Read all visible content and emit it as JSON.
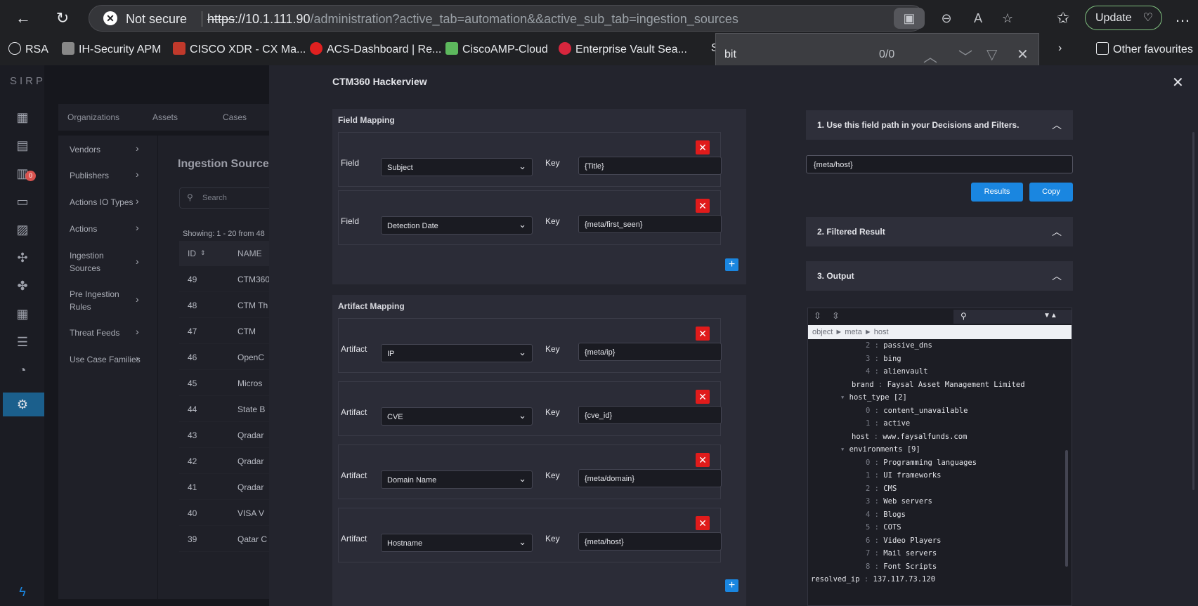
{
  "browser": {
    "security_label": "Not secure",
    "url_proto": "https",
    "url_host": "://10.1.111.90",
    "url_rest": "/administration?active_tab=automation&&active_sub_tab=ingestion_sources",
    "update_label": "Update",
    "bookmarks": [
      "RSA",
      "IH-Security APM",
      "CISCO XDR - CX Ma...",
      "ACS-Dashboard | Re...",
      "CiscoAMP-Cloud",
      "Enterprise Vault Sea...",
      "S"
    ],
    "other_favourites": "Other favourites",
    "find": {
      "query": "bit",
      "count": "0/0"
    }
  },
  "app": {
    "logo": "SIRP",
    "top_menu": [
      "Organizations",
      "Assets",
      "Cases"
    ],
    "submenu": [
      {
        "label": "Vendors"
      },
      {
        "label": "Publishers"
      },
      {
        "label": "Actions IO Types"
      },
      {
        "label": "Actions"
      },
      {
        "label": "Ingestion Sources"
      },
      {
        "label": "Pre Ingestion Rules"
      },
      {
        "label": "Threat Feeds"
      },
      {
        "label": "Use Case Families"
      }
    ],
    "badge": "0",
    "ingestion": {
      "title": "Ingestion Sources",
      "search_placeholder": "Search",
      "showing": "Showing: 1 - 20 from 48",
      "headers": [
        "ID",
        "NAME"
      ],
      "rows": [
        {
          "id": "49",
          "name": "CTM360"
        },
        {
          "id": "48",
          "name": "CTM Th"
        },
        {
          "id": "47",
          "name": "CTM"
        },
        {
          "id": "46",
          "name": "OpenC"
        },
        {
          "id": "45",
          "name": "Micros"
        },
        {
          "id": "44",
          "name": "State B"
        },
        {
          "id": "43",
          "name": "Qradar"
        },
        {
          "id": "42",
          "name": "Qradar"
        },
        {
          "id": "41",
          "name": "Qradar"
        },
        {
          "id": "40",
          "name": "VISA V"
        },
        {
          "id": "39",
          "name": "Qatar C"
        }
      ]
    }
  },
  "modal": {
    "title": "CTM360 Hackerview",
    "field_mapping": {
      "title": "Field Mapping",
      "rows": [
        {
          "label": "Field",
          "value": "Subject",
          "key_label": "Key",
          "key": "{Title}"
        },
        {
          "label": "Field",
          "value": "Detection Date",
          "key_label": "Key",
          "key": "{meta/first_seen}"
        }
      ]
    },
    "artifact_mapping": {
      "title": "Artifact Mapping",
      "rows": [
        {
          "label": "Artifact",
          "value": "IP",
          "key_label": "Key",
          "key": "{meta/ip}"
        },
        {
          "label": "Artifact",
          "value": "CVE",
          "key_label": "Key",
          "key": "{cve_id}"
        },
        {
          "label": "Artifact",
          "value": "Domain Name",
          "key_label": "Key",
          "key": "{meta/domain}"
        },
        {
          "label": "Artifact",
          "value": "Hostname",
          "key_label": "Key",
          "key": "{meta/host}"
        }
      ]
    },
    "right": {
      "step1": "1. Use this field path in your Decisions and Filters.",
      "field_path": "{meta/host}",
      "results_label": "Results",
      "copy_label": "Copy",
      "step2": "2. Filtered Result",
      "step3": "3. Output",
      "json_path": "object ► meta ► host",
      "json_lines": [
        {
          "indent": 3,
          "key": "2",
          "value": "passive_dns"
        },
        {
          "indent": 3,
          "key": "3",
          "value": "bing"
        },
        {
          "indent": 3,
          "key": "4",
          "value": "alienvault"
        },
        {
          "indent": 1,
          "key": "brand",
          "value": "Faysal Asset Management Limited"
        },
        {
          "indent": 1,
          "key": "host_type [2]",
          "value": "",
          "expand": true
        },
        {
          "indent": 3,
          "key": "0",
          "value": "content_unavailable"
        },
        {
          "indent": 3,
          "key": "1",
          "value": "active"
        },
        {
          "indent": 1,
          "key": "host",
          "value": "www.faysalfunds.com"
        },
        {
          "indent": 1,
          "key": "environments [9]",
          "value": "",
          "expand": true
        },
        {
          "indent": 3,
          "key": "0",
          "value": "Programming languages"
        },
        {
          "indent": 3,
          "key": "1",
          "value": "UI frameworks"
        },
        {
          "indent": 3,
          "key": "2",
          "value": "CMS"
        },
        {
          "indent": 3,
          "key": "3",
          "value": "Web servers"
        },
        {
          "indent": 3,
          "key": "4",
          "value": "Blogs"
        },
        {
          "indent": 3,
          "key": "5",
          "value": "COTS"
        },
        {
          "indent": 3,
          "key": "6",
          "value": "Video Players"
        },
        {
          "indent": 3,
          "key": "7",
          "value": "Mail servers"
        },
        {
          "indent": 3,
          "key": "8",
          "value": "Font Scripts"
        },
        {
          "indent": 0,
          "key": "resolved_ip",
          "value": "137.117.73.120"
        }
      ]
    }
  }
}
